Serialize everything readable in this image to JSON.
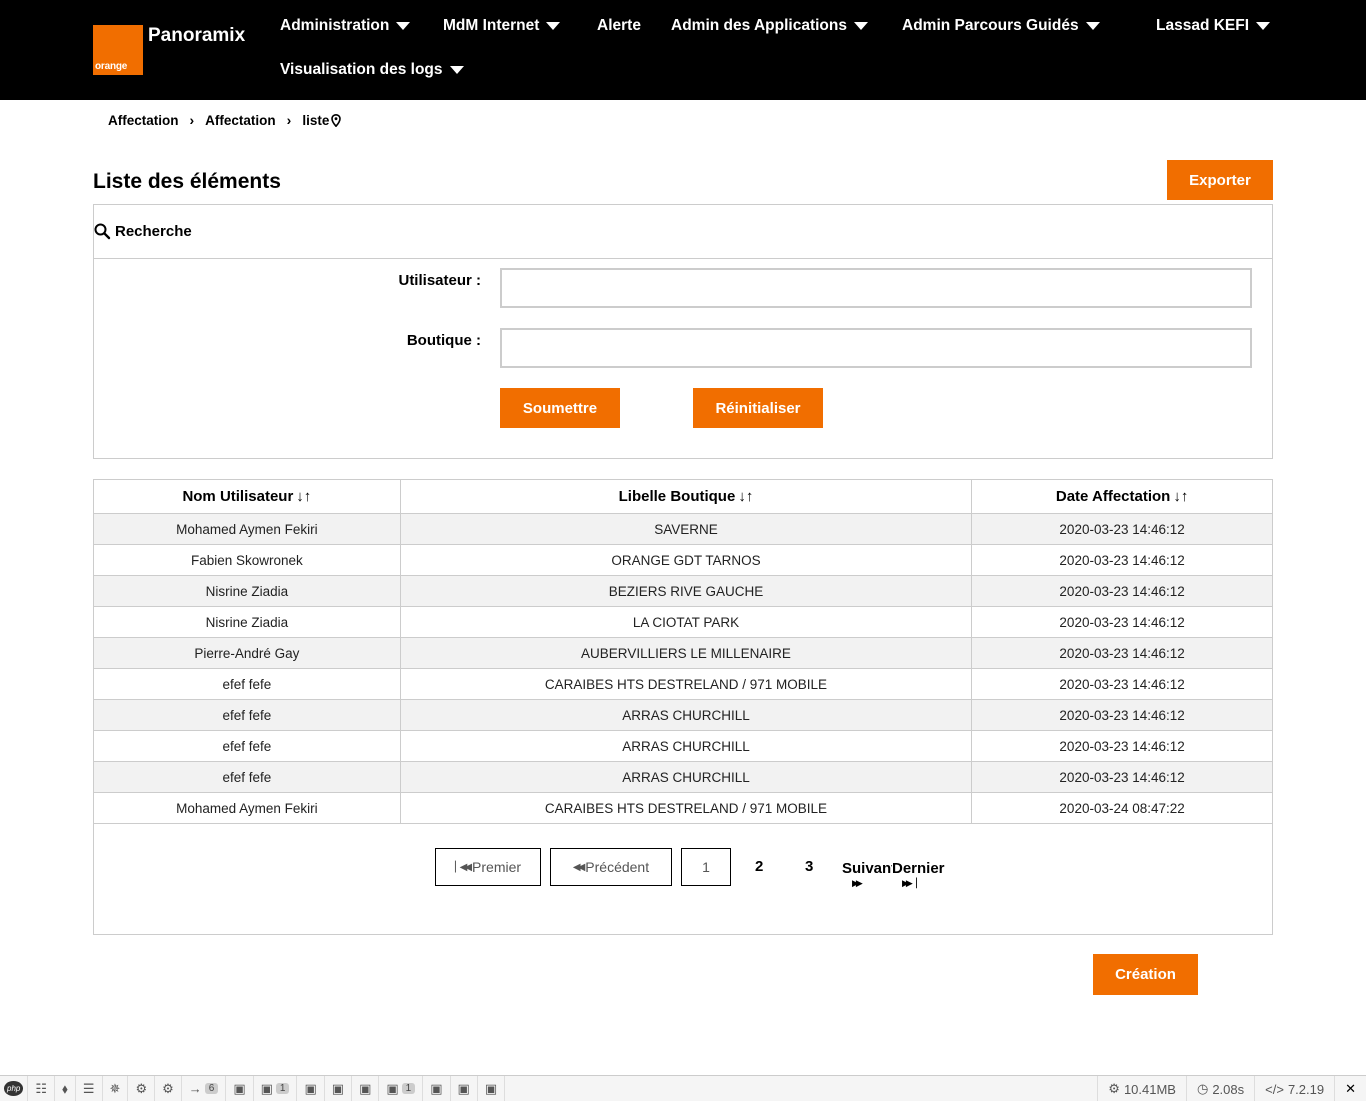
{
  "header": {
    "logo_text": "orange",
    "brand": "Panoramix",
    "nav": [
      {
        "label": "Administration",
        "dropdown": true
      },
      {
        "label": "MdM Internet",
        "dropdown": true
      },
      {
        "label": "Alerte",
        "dropdown": false
      },
      {
        "label": "Admin des Applications",
        "dropdown": true
      },
      {
        "label": "Admin Parcours Guidés",
        "dropdown": true
      },
      {
        "label": "Visualisation des logs",
        "dropdown": true
      }
    ],
    "user": "Lassad KEFI"
  },
  "breadcrumb": [
    "Affectation",
    "Affectation",
    "liste"
  ],
  "page": {
    "title": "Liste des éléments",
    "export_label": "Exporter",
    "create_label": "Création"
  },
  "search": {
    "heading": "Recherche",
    "user_label": "Utilisateur :",
    "user_value": "",
    "shop_label": "Boutique :",
    "shop_value": "",
    "submit_label": "Soumettre",
    "reset_label": "Réinitialiser"
  },
  "table": {
    "headers": [
      "Nom Utilisateur",
      "Libelle Boutique",
      "Date Affectation"
    ],
    "rows": [
      [
        "Mohamed Aymen Fekiri",
        "SAVERNE",
        "2020-03-23 14:46:12"
      ],
      [
        "Fabien Skowronek",
        "ORANGE GDT TARNOS",
        "2020-03-23 14:46:12"
      ],
      [
        "Nisrine Ziadia",
        "BEZIERS RIVE GAUCHE",
        "2020-03-23 14:46:12"
      ],
      [
        "Nisrine Ziadia",
        "LA CIOTAT PARK",
        "2020-03-23 14:46:12"
      ],
      [
        "Pierre-André Gay",
        "AUBERVILLIERS LE MILLENAIRE",
        "2020-03-23 14:46:12"
      ],
      [
        "efef fefe",
        "CARAIBES HTS DESTRELAND / 971 MOBILE",
        "2020-03-23 14:46:12"
      ],
      [
        "efef fefe",
        "ARRAS CHURCHILL",
        "2020-03-23 14:46:12"
      ],
      [
        "efef fefe",
        "ARRAS CHURCHILL",
        "2020-03-23 14:46:12"
      ],
      [
        "efef fefe",
        "ARRAS CHURCHILL",
        "2020-03-23 14:46:12"
      ],
      [
        "Mohamed Aymen Fekiri",
        "CARAIBES HTS DESTRELAND / 971 MOBILE",
        "2020-03-24 08:47:22"
      ]
    ]
  },
  "pagination": {
    "first": "Premier",
    "prev": "Précédent",
    "pages": [
      "1",
      "2",
      "3"
    ],
    "current": "1",
    "next": "Suivant",
    "last": "Dernier"
  },
  "debugbar": {
    "php_label": "php",
    "badges": [
      "6",
      "1",
      "1"
    ],
    "memory": "10.41MB",
    "time": "2.08s",
    "version": "7.2.19"
  },
  "colors": {
    "accent": "#f16e00",
    "header_bg": "#000000"
  }
}
